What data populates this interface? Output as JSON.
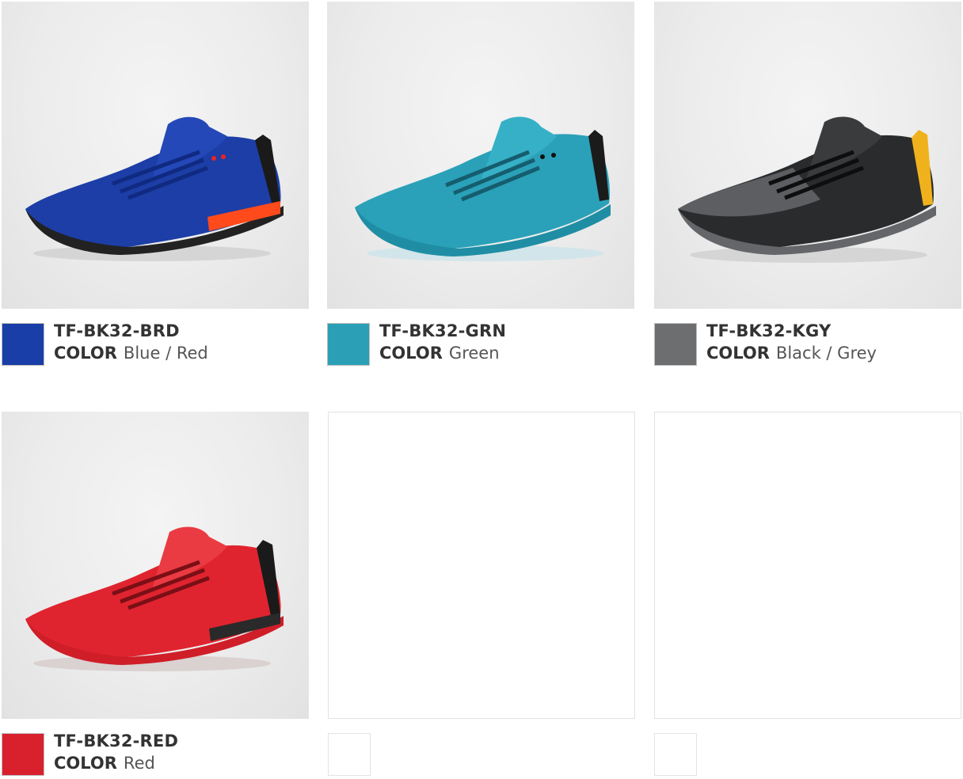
{
  "products": [
    {
      "code": "TF-BK32-BRD",
      "color_label": "COLOR",
      "color_name": "Blue / Red",
      "swatch": "#1a3ea8",
      "icon": "barefoot-shoe-blue-red"
    },
    {
      "code": "TF-BK32-GRN",
      "color_label": "COLOR",
      "color_name": "Green",
      "swatch": "#2b9fb6",
      "icon": "barefoot-shoe-teal"
    },
    {
      "code": "TF-BK32-KGY",
      "color_label": "COLOR",
      "color_name": "Black / Grey",
      "swatch": "#6d6e70",
      "icon": "barefoot-shoe-black-grey"
    },
    {
      "code": "TF-BK32-RED",
      "color_label": "COLOR",
      "color_name": "Red",
      "swatch": "#d9202d",
      "icon": "barefoot-shoe-red"
    }
  ],
  "empty_slots": 2
}
